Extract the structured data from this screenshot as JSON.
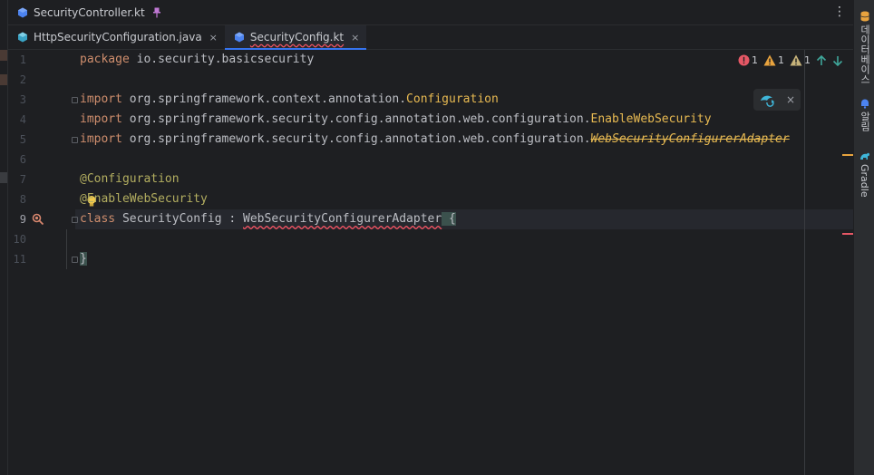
{
  "pinned_tab": {
    "label": "SecurityController.kt",
    "file_type": "kotlin-file-icon"
  },
  "tabs": [
    {
      "label": "HttpSecurityConfiguration.java",
      "file_type": "java-file-icon",
      "active": false
    },
    {
      "label": "SecurityConfig.kt",
      "file_type": "kotlin-file-icon",
      "active": true
    }
  ],
  "close_glyph": "×",
  "more_glyph": "⋮",
  "line_numbers": [
    "1",
    "2",
    "3",
    "4",
    "5",
    "6",
    "7",
    "8",
    "9",
    "10",
    "11"
  ],
  "current_line": "9",
  "code": {
    "l1": {
      "kw": "package",
      "rest": " io.security.basicsecurity"
    },
    "l3": {
      "kw": "import",
      "path": " org.springframework.context.annotation.",
      "cls": "Configuration"
    },
    "l4": {
      "kw": "import",
      "path": " org.springframework.security.config.annotation.web.configuration.",
      "cls": "EnableWebSecurity"
    },
    "l5": {
      "kw": "import",
      "path": " org.springframework.security.config.annotation.web.configuration.",
      "cls": "WebSecurityConfigurerAdapter"
    },
    "l7": {
      "ann": "@Configuration"
    },
    "l8": {
      "ann": "@EnableWebSecurity"
    },
    "l9": {
      "kw": "class",
      "name": " SecurityConfig : ",
      "err": "WebSecurityConfigurerAdapter",
      "brace": " {"
    },
    "l11": {
      "brace": "}"
    }
  },
  "inspections": {
    "errors": "1",
    "warnings": "1",
    "weak_warnings": "1"
  },
  "right_bar": {
    "database_label": "데이터베이스",
    "notifications_label": "알림",
    "gradle_label": "Gradle"
  },
  "colors": {
    "accent": "#3574f0",
    "error": "#f75464",
    "warning": "#e8a33e",
    "keyword": "#cf8e6d",
    "annotation": "#b3ae60",
    "class": "#e8ba52"
  }
}
